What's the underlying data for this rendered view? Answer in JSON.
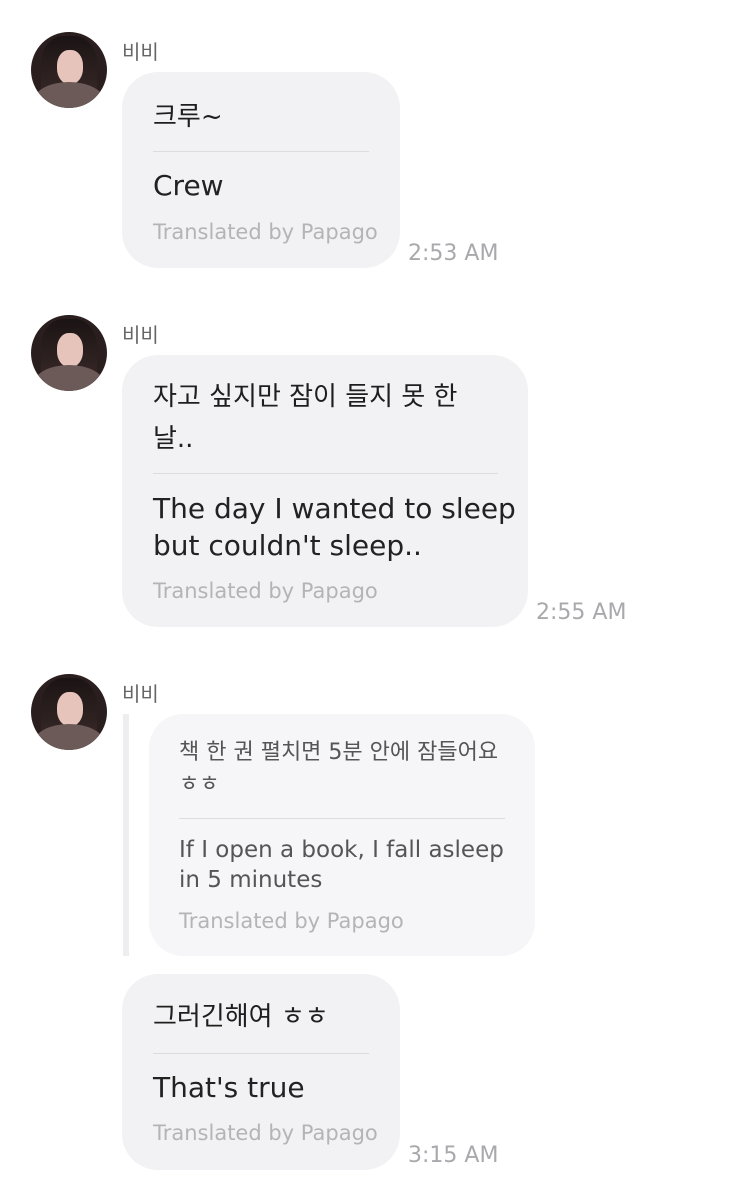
{
  "messages": [
    {
      "sender": "비비",
      "original": "크루~",
      "translation": "Crew",
      "translated_by": "Translated by Papago",
      "time": "2:53 AM"
    },
    {
      "sender": "비비",
      "original_line1": "자고 싶지만 잠이 들지 못 한",
      "original_line2": "날..",
      "translation_line1": "The day I wanted to sleep",
      "translation_line2": "but couldn't sleep..",
      "translated_by": "Translated by Papago",
      "time": "2:55 AM"
    },
    {
      "sender": "비비",
      "quoted": {
        "original_line1": "책 한 권 펼치면 5분 안에 잠들어요",
        "original_line2": "ㅎㅎ",
        "translation_line1": "If I open a book, I fall asleep",
        "translation_line2": "in 5 minutes",
        "translated_by": "Translated by Papago"
      },
      "original": "그러긴해여 ㅎㅎ",
      "translation": "That's true",
      "translated_by": "Translated by Papago",
      "time": "3:15 AM"
    }
  ]
}
